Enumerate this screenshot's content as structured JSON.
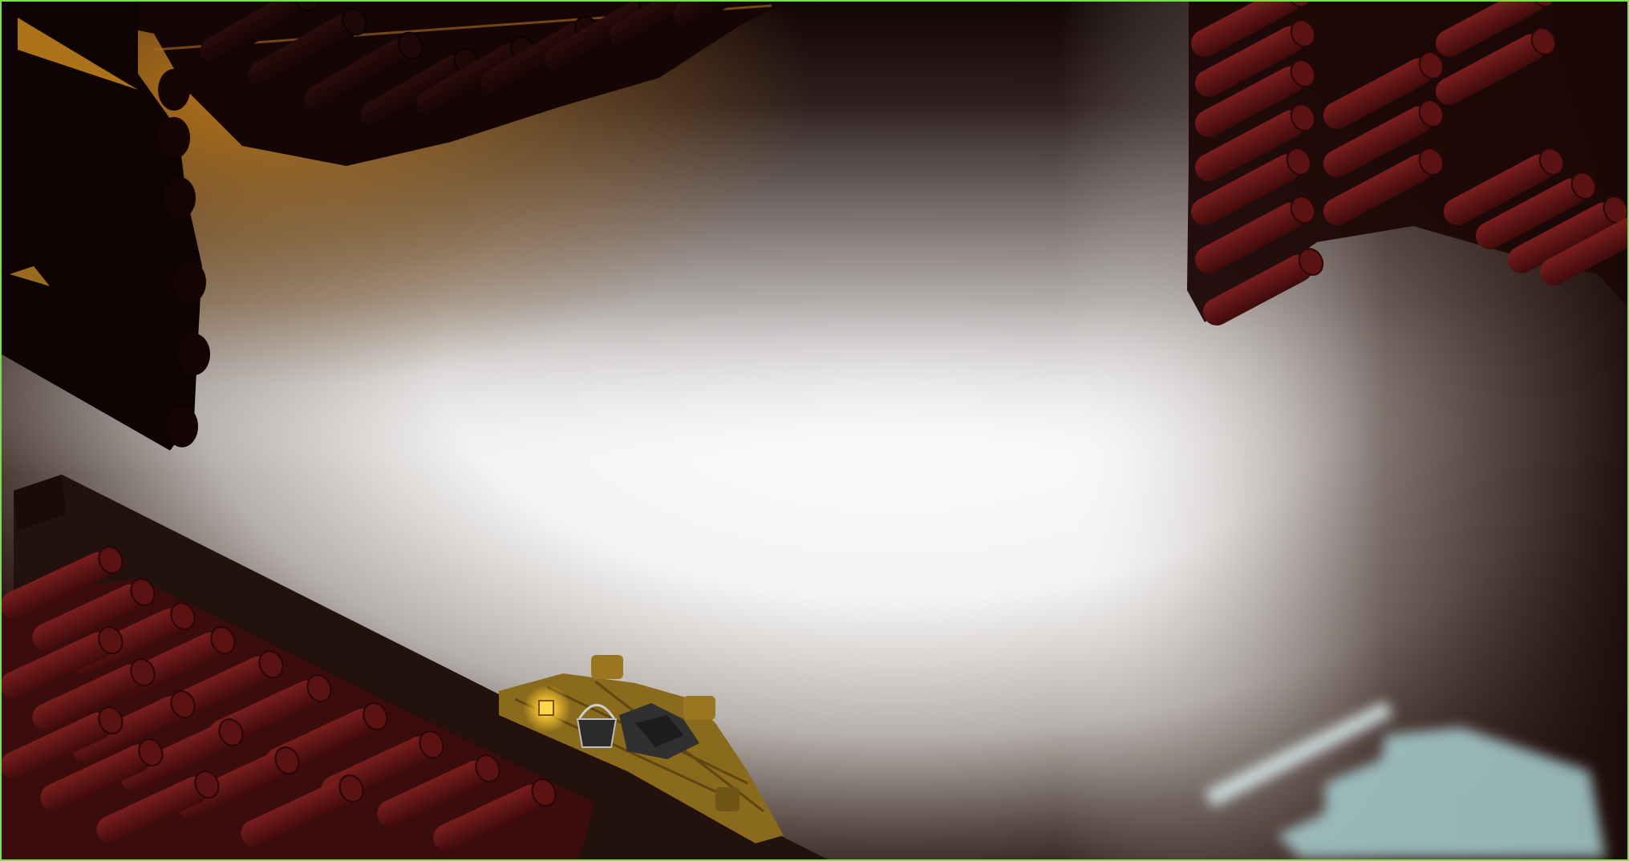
{
  "scene": {
    "name": "isometric-interior-top-down",
    "objects": [
      "log-roof-top-left",
      "log-wall-left",
      "log-roof-top-right",
      "log-roof-bottom-left",
      "dark-beam",
      "wooden-deck",
      "lantern",
      "bucket",
      "coal-sack",
      "window-light-patch"
    ],
    "colors": {
      "frame_border": "#7be04a",
      "log_dark": "#1a0606",
      "log_red": "#6a1818",
      "beam": "#22110d",
      "deck": "#8a6a1c",
      "lantern_glow": "#ffcc33",
      "warm_light": "#b97a22",
      "cool_light": "#a9cfd2"
    }
  }
}
